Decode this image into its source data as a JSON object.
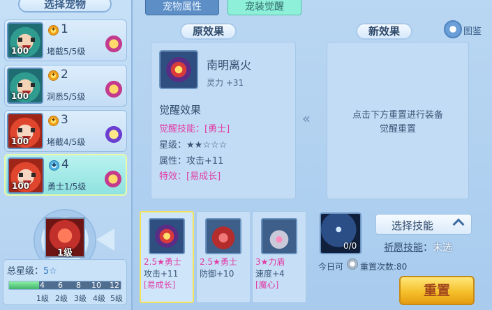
{
  "left": {
    "title": "选择宠物",
    "pets": [
      {
        "rank": "1",
        "level": "100",
        "skill": "堵截5/5级",
        "portrait": "green",
        "rank_icon": "gold-rank-icon"
      },
      {
        "rank": "2",
        "level": "100",
        "skill": "洞悉5/5级",
        "portrait": "green",
        "rank_icon": "gold-rank-icon"
      },
      {
        "rank": "3",
        "level": "100",
        "skill": "堵截4/5级",
        "portrait": "red",
        "rank_icon": "gold-rank-icon"
      },
      {
        "rank": "4",
        "level": "100",
        "skill": "勇士1/5级",
        "portrait": "red",
        "rank_icon": "blue-rank-icon",
        "selected": true
      }
    ],
    "big_skill_level": "1级",
    "total_star_label": "总星级：",
    "total_star_value": "5☆",
    "progress_fraction": 0.27,
    "ticks": [
      "4",
      "6",
      "8",
      "10",
      "12"
    ],
    "sublevels": [
      "1级",
      "2级",
      "3级",
      "4级",
      "5级"
    ]
  },
  "tabs": {
    "pet_attr": "宠物属性",
    "pet_equip_awaken": "宠装觉醒"
  },
  "original": {
    "header": "原效果",
    "equip_name": "南明离火",
    "equip_stat": "灵力 +31",
    "awaken_title": "觉醒效果",
    "skill_label": "觉醒技能：",
    "skill_value": "[勇士]",
    "star_label": "星级：",
    "star_value": "★★☆☆☆",
    "attr_label": "属性：",
    "attr_value": "攻击+11",
    "special_label": "特效：",
    "special_value": "[易成长]"
  },
  "new_effect": {
    "header": "新效果",
    "line1": "点击下方重置进行装备",
    "line2": "觉醒重置",
    "tujian": "图鉴"
  },
  "equip_list": [
    {
      "title": "2.5★勇士",
      "stat": "攻击+11",
      "tag": "[易成长]",
      "selected": true
    },
    {
      "title": "2.5★勇士",
      "stat": "防御+10",
      "tag": "",
      "selected": false
    },
    {
      "title": "3★力盾",
      "stat": "速度+4",
      "tag": "[魔心]",
      "selected": false
    }
  ],
  "right": {
    "orb_count": "0/0",
    "select_skill": "选择技能",
    "wish_label": "祈愿技能",
    "wish_sep": "：",
    "wish_value": "未选",
    "today_prefix": "今日可",
    "reset_count": "重置次数:80",
    "reset_button": "重置"
  },
  "colors": {
    "accent_pink": "#e03da6",
    "button_gold": "#f5c02b",
    "tab_active": "#8ef0d8"
  }
}
